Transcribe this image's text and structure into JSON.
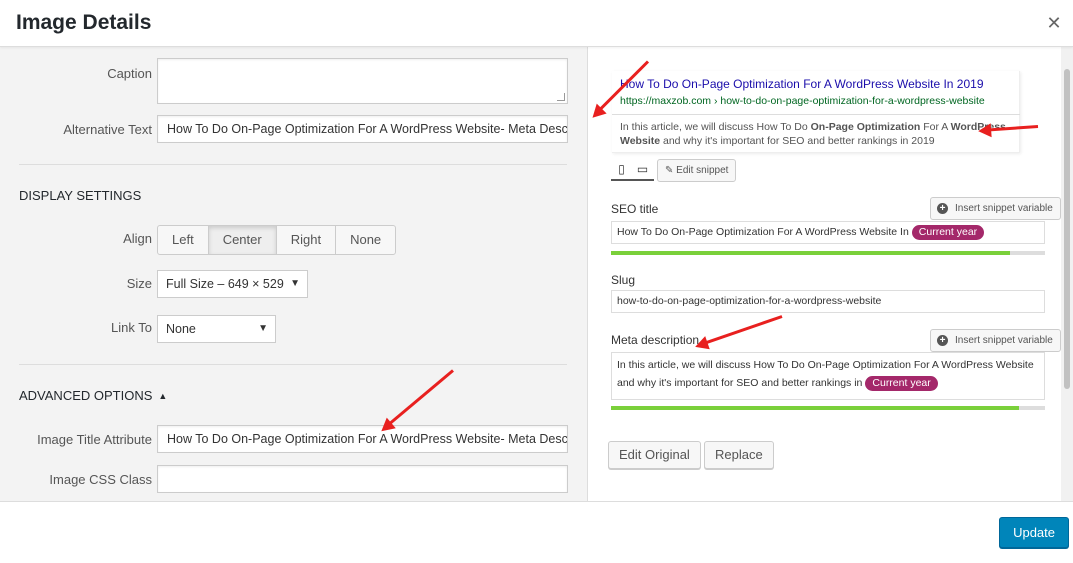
{
  "header": {
    "title": "Image Details",
    "close_glyph": "✕"
  },
  "attachment": {
    "caption_label": "Caption",
    "caption_value": "",
    "alt_label": "Alternative Text",
    "alt_value": "How To Do On-Page Optimization For A WordPress Website- Meta Descrip"
  },
  "display": {
    "section_title": "DISPLAY SETTINGS",
    "align_label": "Align",
    "align_options": [
      "Left",
      "Center",
      "Right",
      "None"
    ],
    "align_selected": "Center",
    "size_label": "Size",
    "size_value": "Full Size – 649 × 529",
    "link_label": "Link To",
    "link_value": "None"
  },
  "advanced": {
    "section_title": "ADVANCED OPTIONS",
    "title_attr_label": "Image Title Attribute",
    "title_attr_value": "How To Do On-Page Optimization For A WordPress Website- Meta Descrip",
    "css_class_label": "Image CSS Class",
    "css_class_value": ""
  },
  "snippet": {
    "title": "How To Do On-Page Optimization For A WordPress Website In 2019",
    "url": "https://maxzob.com › how-to-do-on-page-optimization-for-a-wordpress-website",
    "desc_1": "In this article, we will discuss How To Do ",
    "desc_bold_1": "On-Page Optimization",
    "desc_2": " For A ",
    "desc_bold_2": "WordPress Website",
    "desc_3": " and why it's important for SEO and better rankings in 2019",
    "edit_label": "Edit snippet"
  },
  "seo": {
    "seo_title_label": "SEO title",
    "insert_label": "Insert snippet variable",
    "seo_title_value": "How To Do On-Page Optimization For A WordPress Website In",
    "seo_title_pill": "Current year",
    "seo_title_progress": 0.92,
    "slug_label": "Slug",
    "slug_value": "how-to-do-on-page-optimization-for-a-wordpress-website",
    "meta_label": "Meta description",
    "meta_value": "In this article, we will discuss How To Do On-Page Optimization For A WordPress Website and why it's important for SEO and better rankings in",
    "meta_pill": "Current year",
    "meta_progress": 0.94
  },
  "actions": {
    "edit_original": "Edit Original",
    "replace": "Replace",
    "update": "Update"
  },
  "colors": {
    "accent": "#0085ba",
    "annotation_arrow": "#e8201f",
    "pill": "#a4286a",
    "progress_good": "#7ad03a"
  }
}
